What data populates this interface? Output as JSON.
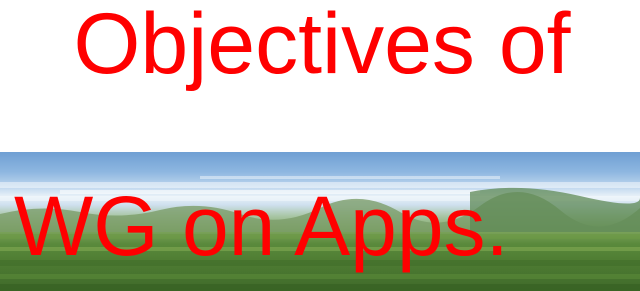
{
  "slide": {
    "title_line_1": "Objectives of",
    "title_line_2": "WG on Apps.",
    "colors": {
      "title": "#ff0000",
      "background": "#ffffff",
      "sky": "#8db6e0",
      "grass": "#4f7d33"
    }
  }
}
